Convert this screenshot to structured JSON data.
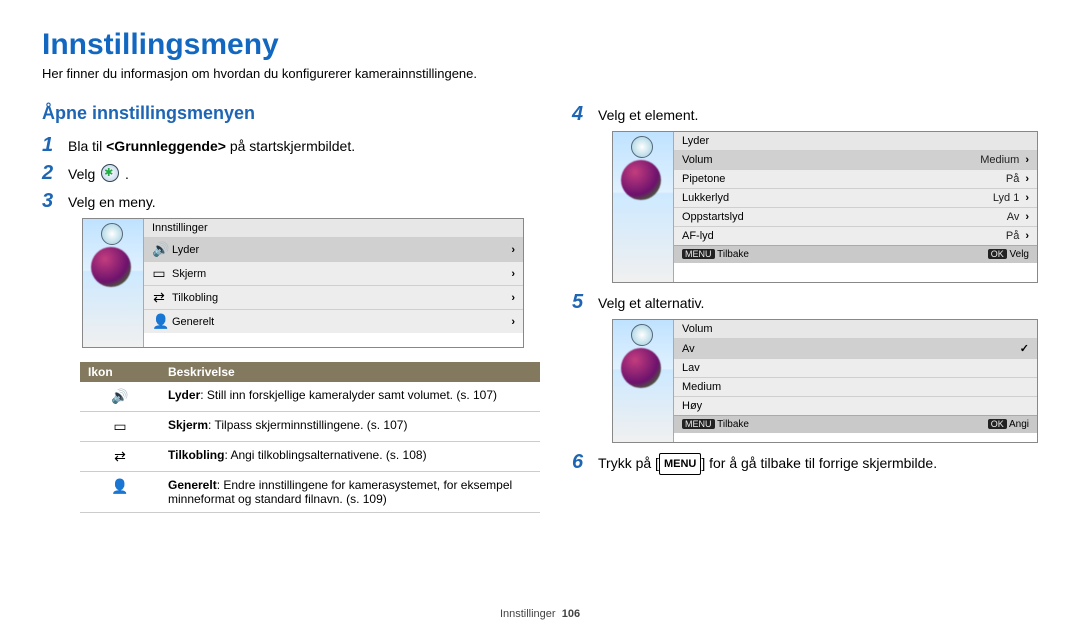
{
  "title": "Innstillingsmeny",
  "intro": "Her finner du informasjon om hvordan du konfigurerer kamerainnstillingene.",
  "subhead": "Åpne innstillingsmenyen",
  "steps": {
    "s1_pre": "Bla til ",
    "s1_bold": "<Grunnleggende>",
    "s1_post": " på startskjermbildet.",
    "s2": "Velg ",
    "s3": "Velg en meny.",
    "s4": "Velg et element.",
    "s5": "Velg et alternativ.",
    "s6_pre": "Trykk på [",
    "s6_btn": "MENU",
    "s6_post": "] for å gå tilbake til forrige skjermbilde."
  },
  "num": {
    "n1": "1",
    "n2": "2",
    "n3": "3",
    "n4": "4",
    "n5": "5",
    "n6": "6"
  },
  "cam1": {
    "title": "Innstillinger",
    "rows": [
      "Lyder",
      "Skjerm",
      "Tilkobling",
      "Generelt"
    ]
  },
  "cam2": {
    "title": "Lyder",
    "rows": [
      {
        "l": "Volum",
        "v": "Medium"
      },
      {
        "l": "Pipetone",
        "v": "På"
      },
      {
        "l": "Lukkerlyd",
        "v": "Lyd 1"
      },
      {
        "l": "Oppstartslyd",
        "v": "Av"
      },
      {
        "l": "AF-lyd",
        "v": "På"
      }
    ],
    "bar": {
      "left_btn": "MENU",
      "left": "Tilbake",
      "right_btn": "OK",
      "right": "Velg"
    }
  },
  "cam3": {
    "title": "Volum",
    "rows": [
      "Av",
      "Lav",
      "Medium",
      "Høy"
    ],
    "bar": {
      "left_btn": "MENU",
      "left": "Tilbake",
      "right_btn": "OK",
      "right": "Angi"
    }
  },
  "table": {
    "h1": "Ikon",
    "h2": "Beskrivelse",
    "r1b": "Lyder",
    "r1": ": Still inn forskjellige kameralyder samt volumet. (s. 107)",
    "r2b": "Skjerm",
    "r2": ": Tilpass skjerminnstillingene. (s. 107)",
    "r3b": "Tilkobling",
    "r3": ": Angi tilkoblingsalternativene. (s. 108)",
    "r4b": "Generelt",
    "r4": ": Endre innstillingene for kamerasystemet, for eksempel minneformat og standard filnavn. (s. 109)"
  },
  "footer": {
    "section": "Innstillinger",
    "page": "106"
  }
}
